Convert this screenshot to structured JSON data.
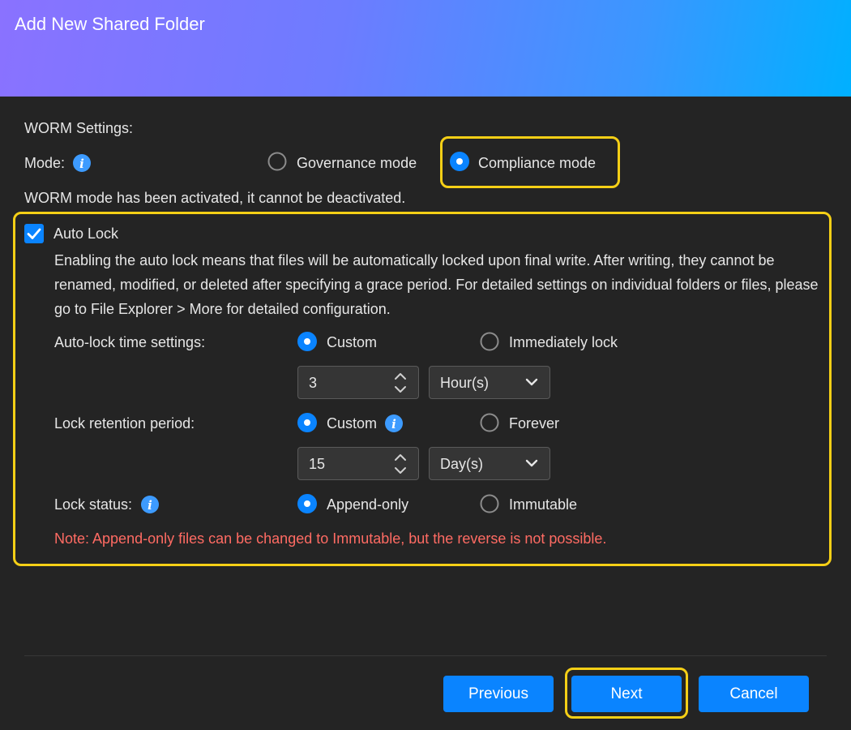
{
  "dialog": {
    "title": "Add New Shared Folder"
  },
  "worm": {
    "section_label": "WORM Settings:",
    "mode_label": "Mode:",
    "mode_info_icon": "info-icon",
    "modes": [
      {
        "label": "Governance mode",
        "selected": false
      },
      {
        "label": "Compliance mode",
        "selected": true
      }
    ],
    "activated_text": "WORM mode has been activated, it cannot be deactivated."
  },
  "auto_lock": {
    "label": "Auto Lock",
    "checked": true,
    "description": "Enabling the auto lock means that files will be automatically locked upon final write. After writing, they cannot be renamed, modified, or deleted after specifying a grace period. For detailed settings on individual folders or files, please go to File Explorer > More for detailed configuration.",
    "time_settings": {
      "label": "Auto-lock time settings:",
      "options": [
        {
          "label": "Custom",
          "selected": true
        },
        {
          "label": "Immediately lock",
          "selected": false
        }
      ],
      "value": "3",
      "unit": "Hour(s)"
    },
    "retention": {
      "label": "Lock retention period:",
      "options": [
        {
          "label": "Custom",
          "selected": true
        },
        {
          "label": "Forever",
          "selected": false
        }
      ],
      "value": "15",
      "unit": "Day(s)"
    },
    "status": {
      "label": "Lock status:",
      "options": [
        {
          "label": "Append-only",
          "selected": true
        },
        {
          "label": "Immutable",
          "selected": false
        }
      ]
    },
    "note": "Note: Append-only files can be changed to Immutable, but the reverse is not possible."
  },
  "footer": {
    "previous_label": "Previous",
    "next_label": "Next",
    "cancel_label": "Cancel"
  },
  "colors": {
    "accent": "#0a84ff",
    "highlight": "#f5cf16",
    "note": "#ff6b63",
    "background": "#242424"
  }
}
